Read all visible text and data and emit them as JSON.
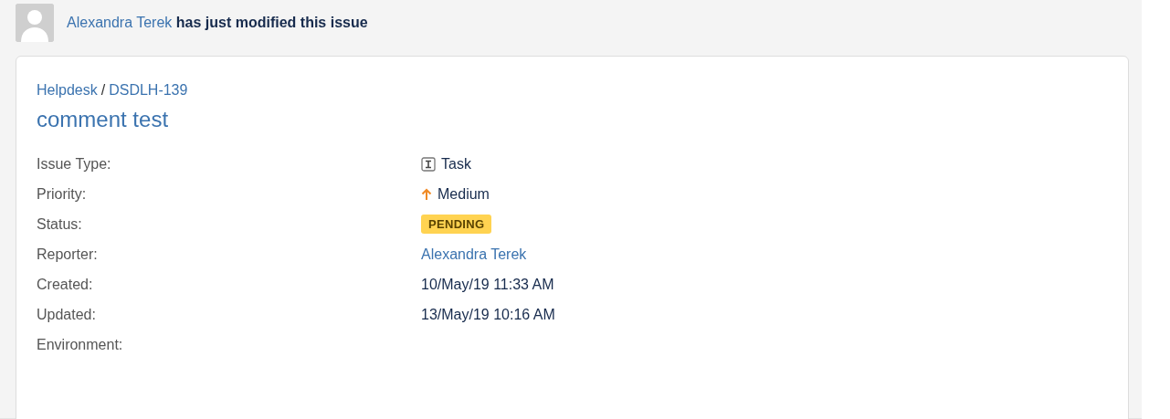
{
  "notification": {
    "user": "Alexandra Terek",
    "message": "has just modified this issue"
  },
  "issue": {
    "project": "Helpdesk",
    "separator": "/",
    "key": "DSDLH-139",
    "summary": "comment test",
    "fields": [
      {
        "label": "Issue Type:",
        "kind": "type",
        "value": "Task"
      },
      {
        "label": "Priority:",
        "kind": "priority",
        "value": "Medium"
      },
      {
        "label": "Status:",
        "kind": "status",
        "value": "PENDING"
      },
      {
        "label": "Reporter:",
        "kind": "user",
        "value": "Alexandra Terek"
      },
      {
        "label": "Created:",
        "kind": "text",
        "value": "10/May/19 11:33 AM"
      },
      {
        "label": "Updated:",
        "kind": "text",
        "value": "13/May/19 10:16 AM"
      },
      {
        "label": "Environment:",
        "kind": "empty"
      }
    ]
  }
}
